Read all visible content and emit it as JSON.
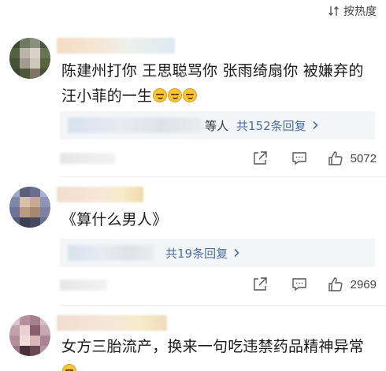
{
  "header": {
    "sort_label": "按热度",
    "sort_icon": "sort-icon"
  },
  "comments": [
    {
      "text": "陈建州打你 王思聪骂你 张雨绮扇你 被嫌弃的汪小菲的一生",
      "emoji_count": 3,
      "reply_suffix": "等人",
      "reply_count_label": "共152条回复",
      "like_count": "5072"
    },
    {
      "text": "《算什么男人》",
      "reply_count_label": "共19条回复",
      "like_count": "2969"
    },
    {
      "text": "女方三胎流产，换来一句吃违禁药品精神异常"
    }
  ],
  "colors": {
    "link": "#4a6fa5",
    "reply_bg": "#f4f5f7",
    "text": "#1a1a1a"
  },
  "icons": [
    "share-icon",
    "comment-icon",
    "like-icon",
    "chevron-right-icon"
  ]
}
